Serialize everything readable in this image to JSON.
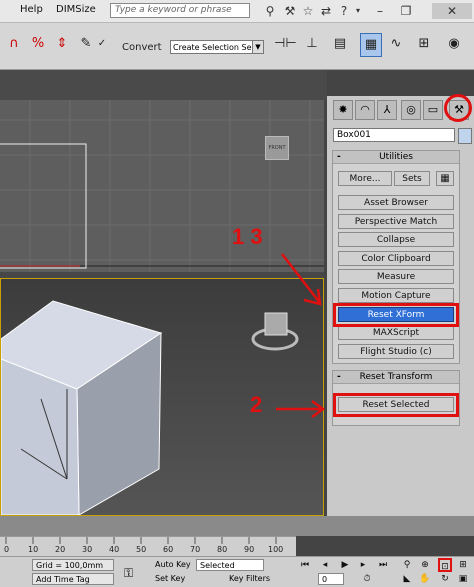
{
  "menu": {
    "help": "Help",
    "dimsize": "DIMSize"
  },
  "search": {
    "placeholder": "Type a keyword or phrase"
  },
  "toolbar": {
    "convert_label": "Convert",
    "selection_set": "Create Selection Se",
    "tool_icons": [
      "magnet-icon",
      "percent-snap-icon",
      "spinner-snap-icon",
      "edit-named-sets-icon",
      "abc-icon"
    ]
  },
  "viewport": {
    "viewcube_label": "FRONT"
  },
  "command_panel": {
    "object_name": "Box001",
    "utilities_title": "Utilities",
    "more_label": "More...",
    "sets_label": "Sets",
    "buttons": [
      "Asset Browser",
      "Perspective Match",
      "Collapse",
      "Color Clipboard",
      "Measure",
      "Motion Capture",
      "Reset XForm",
      "MAXScript",
      "Flight Studio (c)"
    ],
    "reset_transform_title": "Reset Transform",
    "reset_selected_label": "Reset Selected"
  },
  "annotations": {
    "step_13": "1 3",
    "step_2": "2"
  },
  "timeline": {
    "ticks": [
      "0",
      "10",
      "20",
      "30",
      "40",
      "50",
      "60",
      "70",
      "80",
      "90",
      "100"
    ]
  },
  "status": {
    "grid": "Grid = 100,0mm",
    "add_time_tag": "Add Time Tag",
    "auto_key": "Auto Key",
    "selected": "Selected",
    "set_key": "Set Key",
    "key_filters": "Key Filters...",
    "frame": "0"
  },
  "colors": {
    "highlight": "#e01010",
    "active_button": "#2f6fd6"
  }
}
